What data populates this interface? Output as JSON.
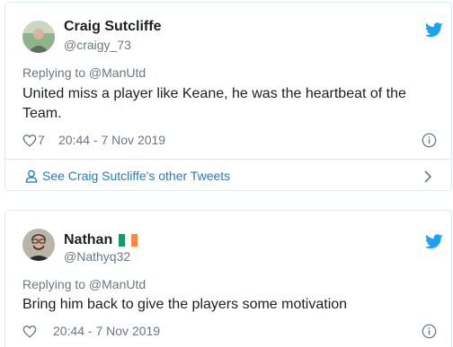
{
  "tweets": [
    {
      "name": "Craig Sutcliffe",
      "handle": "@craigy_73",
      "replying_to": "Replying to @ManUtd",
      "text": "United miss a player like Keane, he was the heartbeat of the Team.",
      "like_count": "7",
      "timestamp": "20:44 - 7 Nov 2019",
      "see_more": "See Craig Sutcliffe's other Tweets"
    },
    {
      "name": "Nathan",
      "handle": "@Nathyq32",
      "replying_to": "Replying to @ManUtd",
      "text": "Bring him back to give the players some motivation",
      "timestamp": "20:44 - 7 Nov 2019"
    }
  ],
  "icons": {
    "bird": "twitter-bird-icon",
    "like": "heart-icon",
    "info": "info-icon",
    "person": "person-icon",
    "chevron": "chevron-right-icon",
    "flag": "ireland-flag-icon"
  },
  "colors": {
    "twitter_blue": "#1da1f2",
    "link_blue": "#2b7bb9",
    "text": "#1c2022",
    "muted": "#697882",
    "border": "#e1e8ed"
  }
}
